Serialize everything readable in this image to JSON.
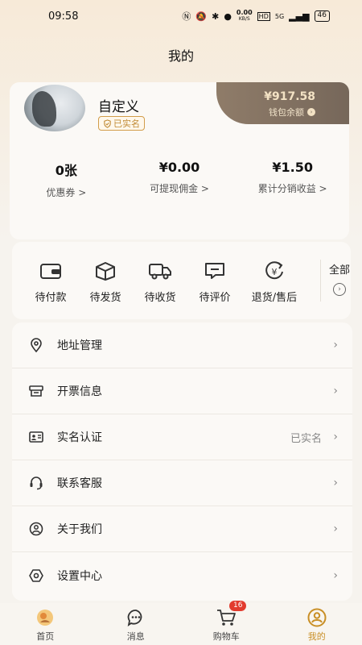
{
  "status_bar": {
    "time": "09:58",
    "net_speed": "0.00",
    "net_unit": "KB/S",
    "signal": "5G",
    "battery": "46"
  },
  "header": {
    "title": "我的"
  },
  "profile": {
    "name": "自定义",
    "verified_label": "已实名",
    "wallet_amount": "¥917.58",
    "wallet_label": "钱包余额"
  },
  "stats": [
    {
      "value": "0张",
      "label": "优惠券 >"
    },
    {
      "value": "¥0.00",
      "label": "可提现佣金 >"
    },
    {
      "value": "¥1.50",
      "label": "累计分销收益 >"
    }
  ],
  "orders": {
    "items": [
      {
        "label": "待付款",
        "icon": "wallet-icon"
      },
      {
        "label": "待发货",
        "icon": "package-icon"
      },
      {
        "label": "待收货",
        "icon": "truck-icon"
      },
      {
        "label": "待评价",
        "icon": "comment-icon"
      },
      {
        "label": "退货/售后",
        "icon": "refund-icon"
      }
    ],
    "all_label": "全部"
  },
  "menu": [
    {
      "label": "地址管理",
      "value": "",
      "icon": "location-icon"
    },
    {
      "label": "开票信息",
      "value": "",
      "icon": "invoice-icon"
    },
    {
      "label": "实名认证",
      "value": "已实名",
      "icon": "id-card-icon"
    },
    {
      "label": "联系客服",
      "value": "",
      "icon": "headset-icon"
    },
    {
      "label": "关于我们",
      "value": "",
      "icon": "about-icon"
    },
    {
      "label": "设置中心",
      "value": "",
      "icon": "settings-icon"
    }
  ],
  "bottom_nav": [
    {
      "label": "首页",
      "icon": "home-icon"
    },
    {
      "label": "消息",
      "icon": "message-icon"
    },
    {
      "label": "购物车",
      "icon": "cart-icon",
      "badge": "16"
    },
    {
      "label": "我的",
      "icon": "profile-icon",
      "active": true
    }
  ],
  "colors": {
    "accent": "#c98f26",
    "badge": "#e23b2e",
    "wallet_bg": "#76675a"
  }
}
